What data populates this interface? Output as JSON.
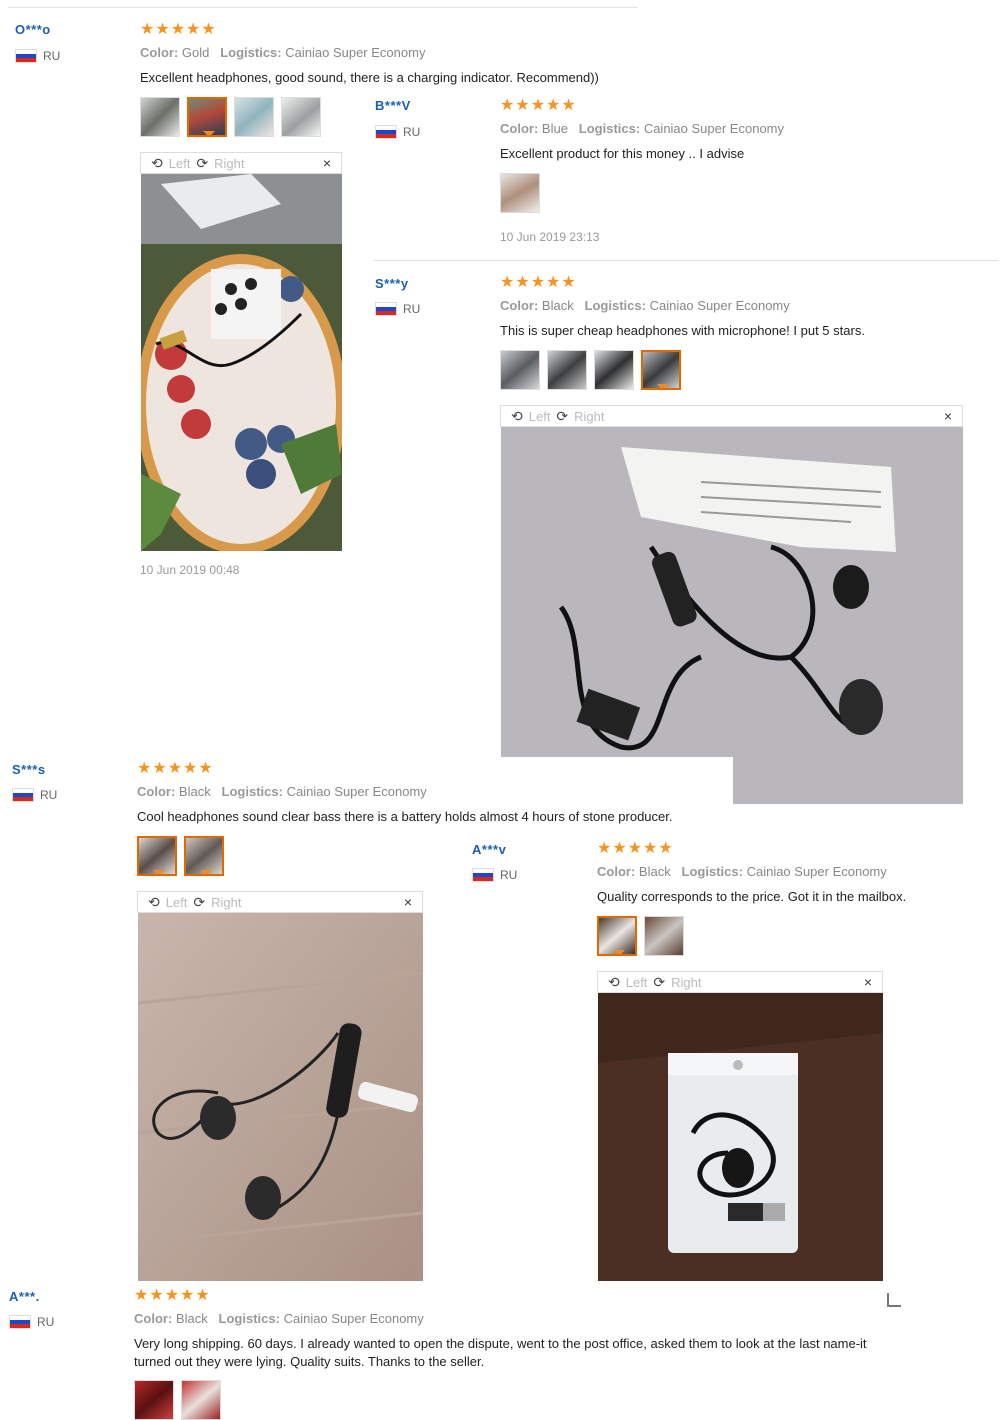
{
  "labels": {
    "color": "Color:",
    "logistics": "Logistics:",
    "left": "Left",
    "right": "Right",
    "close": "×",
    "stars": "★★★★★"
  },
  "reviews": [
    {
      "user": "O***o",
      "country": "RU",
      "color": "Gold",
      "logistics": "Cainiao Super Economy",
      "text": "Excellent headphones, good sound, there is a charging indicator. Recommend))",
      "date": "10 Jun 2019 00:48"
    },
    {
      "user": "B***V",
      "country": "RU",
      "color": "Blue",
      "logistics": "Cainiao Super Economy",
      "text": "Excellent product for this money .. I advise",
      "date": "10 Jun 2019 23:13"
    },
    {
      "user": "S***y",
      "country": "RU",
      "color": "Black",
      "logistics": "Cainiao Super Economy",
      "text": "This is super cheap headphones with microphone! I put 5 stars."
    },
    {
      "user": "S***s",
      "country": "RU",
      "color": "Black",
      "logistics": "Cainiao Super Economy",
      "text": "Cool headphones sound clear bass there is a battery holds almost 4 hours of stone producer."
    },
    {
      "user": "A***v",
      "country": "RU",
      "color": "Black",
      "logistics": "Cainiao Super Economy",
      "text": "Quality corresponds to the price. Got it in the mailbox."
    },
    {
      "user": "A***.",
      "country": "RU",
      "color": "Black",
      "logistics": "Cainiao Super Economy",
      "text_line1": "Very long shipping. 60 days. I already wanted to open the dispute, went to the post office, asked them to look at the last name-it",
      "text_line2": "turned out they were lying. Quality suits. Thanks to the seller."
    }
  ],
  "colors": {
    "star": "#f79420",
    "user": "#1a5fb4",
    "selected_border": "#e06a00"
  }
}
